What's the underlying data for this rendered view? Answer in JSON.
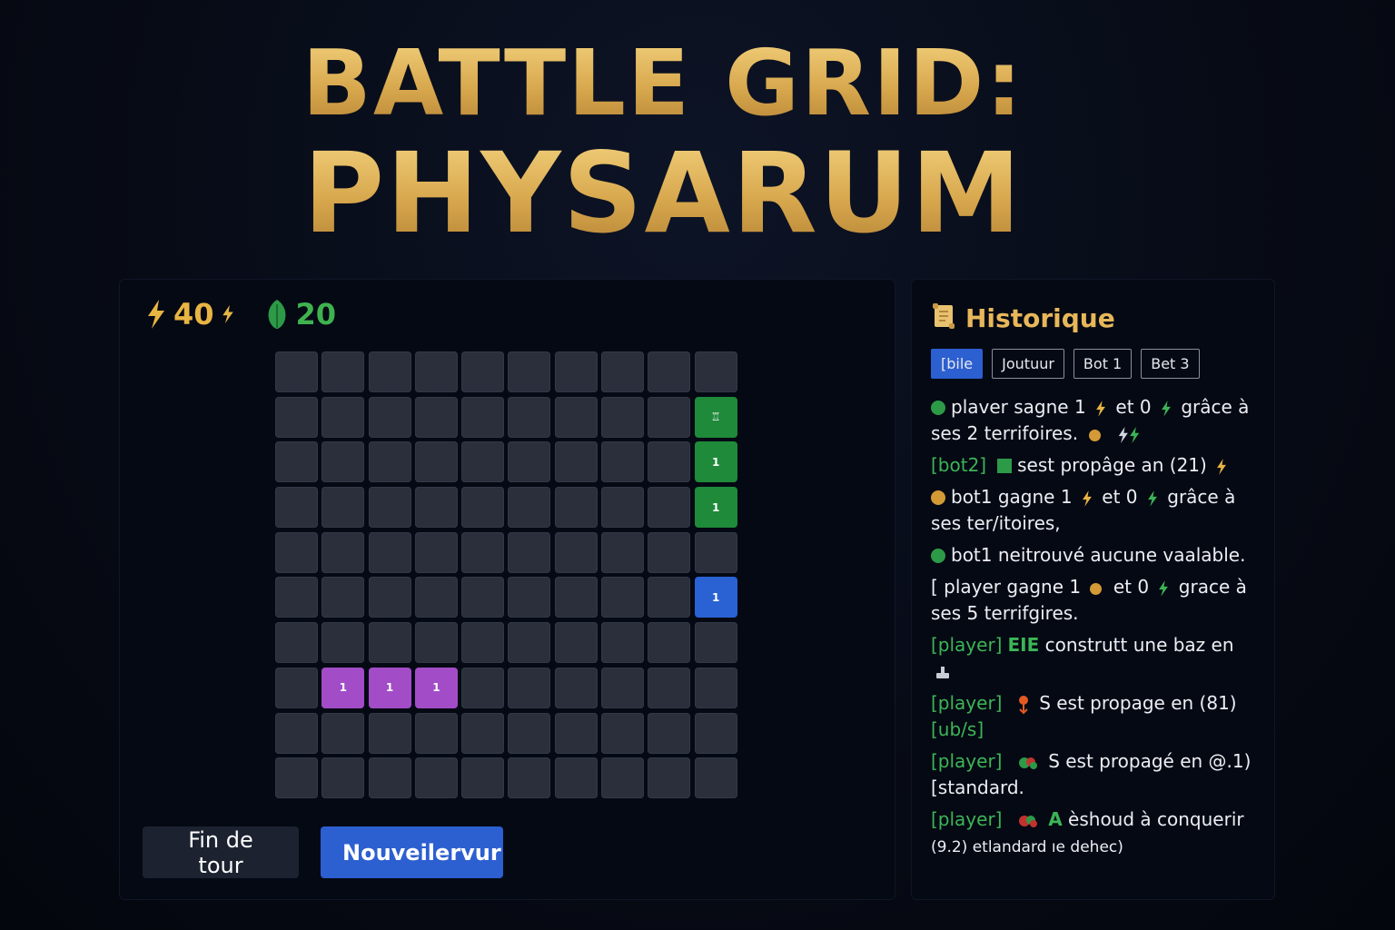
{
  "title": {
    "line1": "BATTLE GRID:",
    "line2": "PHYSARUM"
  },
  "resources": {
    "energy": "40",
    "food": "20"
  },
  "colors": {
    "energy": "#e8b543",
    "food": "#3fb24f",
    "player": "#1e8a3a",
    "bot_blue": "#2a62d4",
    "bot_purple": "#a24dc7",
    "accent": "#2c5fd0"
  },
  "grid": {
    "rows": 10,
    "cols": 10,
    "cells": [
      {
        "row": 1,
        "col": 9,
        "owner": "green",
        "label": "♖"
      },
      {
        "row": 2,
        "col": 9,
        "owner": "green",
        "label": "1"
      },
      {
        "row": 3,
        "col": 9,
        "owner": "green",
        "label": "1"
      },
      {
        "row": 5,
        "col": 9,
        "owner": "blue",
        "label": "1"
      },
      {
        "row": 7,
        "col": 1,
        "owner": "purple",
        "label": "1"
      },
      {
        "row": 7,
        "col": 2,
        "owner": "purple",
        "label": "1"
      },
      {
        "row": 7,
        "col": 3,
        "owner": "purple",
        "label": "1"
      }
    ]
  },
  "buttons": {
    "end_turn": "Fin de tour",
    "new_game": "Nouveilervur"
  },
  "history": {
    "title": "Historique",
    "icon": "scroll-icon",
    "tabs": [
      "[bile",
      "Joutuur",
      "Bot 1",
      "Bet 3"
    ],
    "entries": {
      "e1": {
        "text1": "plaver sagne 1",
        "text2": "et 0",
        "text3": "grâce à ses 2 terrifoires."
      },
      "e2": {
        "tag": "[bot2]",
        "text": "sest propâge an (21)"
      },
      "e3": {
        "text1": "bot1 gagne 1",
        "text2": "et 0",
        "text3": "grâce à ses ter/itoires,"
      },
      "e4": {
        "text": "bot1 neitrouvé aucune vaalable."
      },
      "e5": {
        "text1": "[ player gagne 1",
        "text2": "et 0",
        "text3": "grace à ses 5 terrifgires."
      },
      "e6": {
        "tag": "[player]",
        "strong": "EIE",
        "text": "construtt une baz en"
      },
      "e7": {
        "tag": "[player]",
        "text": "S est propage en (81)",
        "tag2": "[ub/s]"
      },
      "e8": {
        "tag": "[player]",
        "text": "S est propagé en @.1)[standard."
      },
      "e9": {
        "tag": "[player]",
        "strong": "A",
        "text": "èshoud à conquerir",
        "sub": "(9.2) etlandard ıe dehec)"
      }
    }
  }
}
